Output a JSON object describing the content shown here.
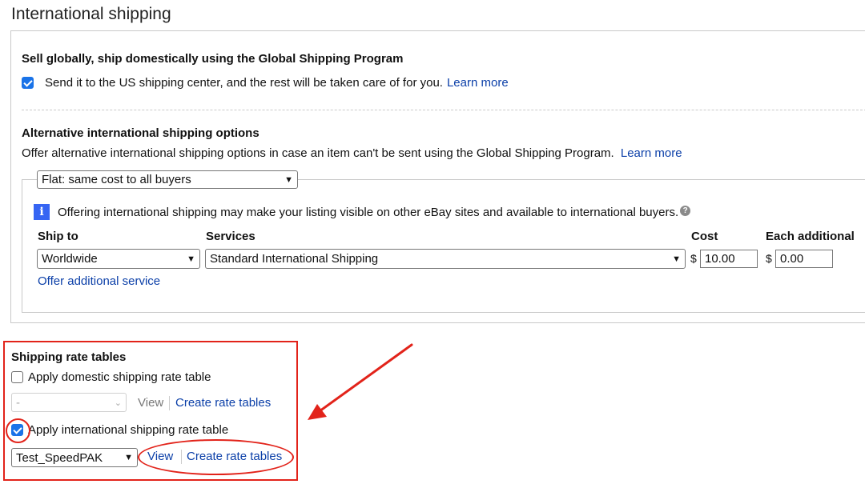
{
  "section_title": "International shipping",
  "gsp": {
    "title": "Sell globally, ship domestically using the Global Shipping Program",
    "checkbox_text": "Send it to the US shipping center, and the rest will be taken care of for you.",
    "learn_more": "Learn more",
    "checked": true
  },
  "alt": {
    "title": "Alternative international shipping options",
    "description": "Offer alternative international shipping options in case an item can't be sent using the Global Shipping Program.",
    "learn_more": "Learn more",
    "cost_type": "Flat: same cost to all buyers",
    "info": "Offering international shipping may make your listing visible on other eBay sites and available to international buyers.",
    "headers": {
      "ship_to": "Ship to",
      "services": "Services",
      "cost": "Cost",
      "each_additional": "Each additional"
    },
    "ship_to": "Worldwide",
    "service": "Standard International Shipping",
    "currency": "$",
    "cost": "10.00",
    "each_additional": "0.00",
    "offer_additional": "Offer additional service"
  },
  "rate_tables": {
    "title": "Shipping rate tables",
    "domestic_label": "Apply domestic shipping rate table",
    "domestic_checked": false,
    "domestic_select": "-",
    "view": "View",
    "create": "Create rate tables",
    "international_label": "Apply international shipping rate table",
    "international_checked": true,
    "international_select": "Test_SpeedPAK"
  },
  "icons": {
    "info": "i",
    "help": "?",
    "chevron": "⌄"
  },
  "colors": {
    "link": "#0b3fa8",
    "annotation": "#e2231a",
    "checkbox": "#1a73e8",
    "info": "#3665f3"
  }
}
